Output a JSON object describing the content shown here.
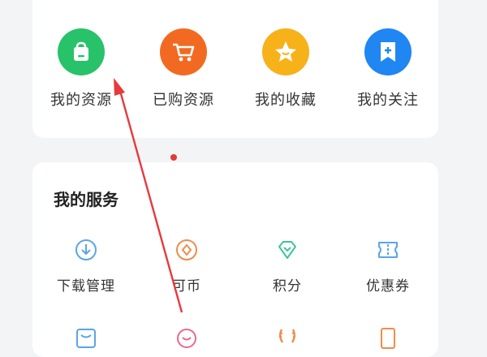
{
  "top_actions": [
    {
      "label": "我的资源",
      "icon": "shopping-bag-icon",
      "color": "#28c26a"
    },
    {
      "label": "已购资源",
      "icon": "shopping-cart-icon",
      "color": "#f26a21"
    },
    {
      "label": "我的收藏",
      "icon": "star-icon",
      "color": "#f7b21a"
    },
    {
      "label": "我的关注",
      "icon": "bookmark-plus-icon",
      "color": "#1f86f2"
    }
  ],
  "services": {
    "title": "我的服务",
    "items": [
      {
        "label": "下载管理",
        "icon": "download-icon",
        "color": "#5aa5e8"
      },
      {
        "label": "可币",
        "icon": "coin-icon",
        "color": "#f08c4a"
      },
      {
        "label": "积分",
        "icon": "diamond-icon",
        "color": "#3cc59a"
      },
      {
        "label": "优惠券",
        "icon": "coupon-icon",
        "color": "#5aa5e8"
      }
    ],
    "row2_icons": [
      {
        "icon": "inbox-icon",
        "color": "#5aa5e8"
      },
      {
        "icon": "smile-icon",
        "color": "#e86a8a"
      },
      {
        "icon": "laurel-icon",
        "color": "#f08c4a"
      },
      {
        "icon": "card-icon",
        "color": "#f08c4a"
      }
    ]
  },
  "annotation": {
    "color": "#e8393b"
  }
}
